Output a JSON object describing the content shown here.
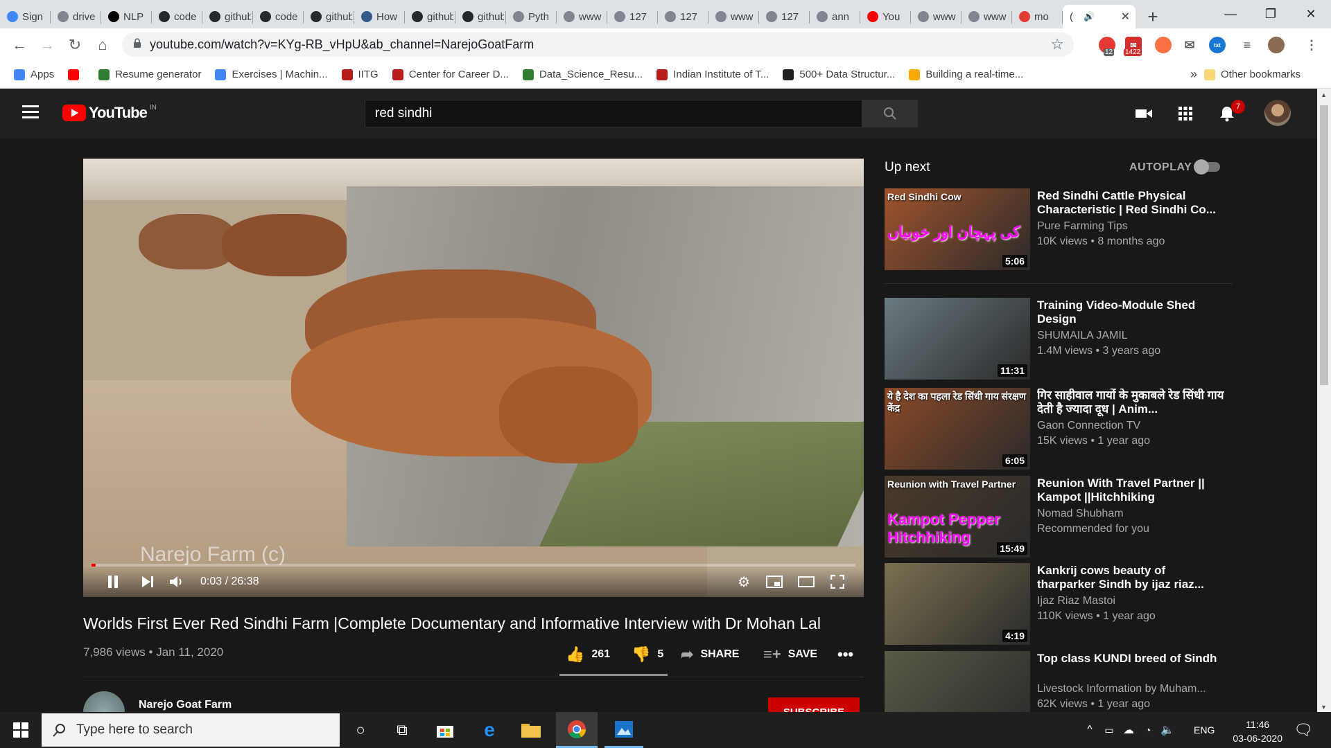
{
  "browser": {
    "tabs": [
      {
        "label": "Sign",
        "icon": "google-icon"
      },
      {
        "label": "drive",
        "icon": "globe-icon"
      },
      {
        "label": "NLP",
        "icon": "medium-icon"
      },
      {
        "label": "code",
        "icon": "github-icon"
      },
      {
        "label": "github",
        "icon": "github-icon"
      },
      {
        "label": "code",
        "icon": "github-icon"
      },
      {
        "label": "github",
        "icon": "github-icon"
      },
      {
        "label": "How",
        "icon": "tds-icon"
      },
      {
        "label": "github",
        "icon": "github-icon"
      },
      {
        "label": "github",
        "icon": "github-icon"
      },
      {
        "label": "Pyth",
        "icon": "globe-icon"
      },
      {
        "label": "www",
        "icon": "globe-icon"
      },
      {
        "label": "127",
        "icon": "globe-icon"
      },
      {
        "label": "127",
        "icon": "globe-icon"
      },
      {
        "label": "www",
        "icon": "globe-icon"
      },
      {
        "label": "127",
        "icon": "globe-icon"
      },
      {
        "label": "ann",
        "icon": "globe-icon"
      },
      {
        "label": "You",
        "icon": "youtube-icon"
      },
      {
        "label": "www",
        "icon": "globe-icon"
      },
      {
        "label": "www",
        "icon": "globe-icon"
      },
      {
        "label": "mo",
        "icon": "red-icon"
      }
    ],
    "active_tab_label": "(",
    "url": "youtube.com/watch?v=KYg-RB_vHpU&ab_channel=NarejoGoatFarm",
    "extension_badges": [
      "12",
      "1422"
    ],
    "bookmarks": [
      {
        "label": "Apps",
        "color": "#4285f4"
      },
      {
        "label": "",
        "color": "#ff0000"
      },
      {
        "label": "Resume generator",
        "color": "#2e7d32"
      },
      {
        "label": "Exercises | Machin...",
        "color": "#4285f4"
      },
      {
        "label": "IITG",
        "color": "#b71c1c"
      },
      {
        "label": "Center for Career D...",
        "color": "#b71c1c"
      },
      {
        "label": "Data_Science_Resu...",
        "color": "#2e7d32"
      },
      {
        "label": "Indian Institute of T...",
        "color": "#b71c1c"
      },
      {
        "label": "500+ Data Structur...",
        "color": "#202124"
      },
      {
        "label": "Building a real-time...",
        "color": "#f9ab00"
      }
    ],
    "more_bookmarks": "»",
    "other_bookmarks": "Other bookmarks"
  },
  "youtube": {
    "logo_text": "YouTube",
    "region": "IN",
    "search_query": "red sindhi",
    "notification_count": "7",
    "video": {
      "watermark": "Narejo Farm (c)",
      "time_current": "0:03",
      "time_total": "26:38",
      "progress": 0.002,
      "title": "Worlds First Ever Red Sindhi Farm |Complete Documentary and Informative Interview with Dr Mohan Lal",
      "views": "7,986 views",
      "date": "Jan 11, 2020",
      "likes": "261",
      "dislikes": "5",
      "share_label": "SHARE",
      "save_label": "SAVE"
    },
    "channel": {
      "name": "Narejo Goat Farm",
      "subscribe_label": "SUBSCRIBE"
    },
    "sidebar": {
      "up_next_label": "Up next",
      "autoplay_label": "AUTOPLAY",
      "autoplay_on": false,
      "recommendations": [
        {
          "title": "Red Sindhi Cattle Physical Characteristic | Red Sindhi Co...",
          "channel": "Pure Farming Tips",
          "meta": "10K views • 8 months ago",
          "duration": "5:06",
          "thumb_text": "Red Sindhi Cow",
          "thumb_subtext": "کی پہچان اور خوبیاں",
          "color": "#a0542c"
        },
        {
          "title": "Training Video-Module Shed Design",
          "channel": "SHUMAILA JAMIL",
          "meta": "1.4M views • 3 years ago",
          "duration": "11:31",
          "thumb_text": "",
          "thumb_subtext": "",
          "color": "#6a7a80"
        },
        {
          "title": "गिर साहीवाल गायों के मुकाबले रेड सिंधी गाय देती है ज्यादा दूध | Anim...",
          "channel": "Gaon Connection TV",
          "meta": "15K views • 1 year ago",
          "duration": "6:05",
          "thumb_text": "ये है देश का पहला रेड सिंधी गाय संरक्षण केंद्र",
          "thumb_subtext": "",
          "color": "#8a4a28"
        },
        {
          "title": "Reunion With Travel Partner || Kampot ||Hitchhiking",
          "channel": "Nomad Shubham",
          "meta": "Recommended for you",
          "duration": "15:49",
          "thumb_text": "Reunion with Travel Partner",
          "thumb_subtext": "Kampot Pepper Hitchhiking",
          "color": "#4a3a2a"
        },
        {
          "title": "Kankrij cows beauty of tharparker Sindh by ijaz riaz...",
          "channel": "Ijaz Riaz Mastoi",
          "meta": "110K views • 1 year ago",
          "duration": "4:19",
          "thumb_text": "",
          "thumb_subtext": "",
          "color": "#7a7050"
        },
        {
          "title": "Top class KUNDI breed of Sindh",
          "channel": "Livestock Information by Muham...",
          "meta": "62K views • 1 year ago",
          "duration": "",
          "thumb_text": "",
          "thumb_subtext": "",
          "color": "#5a5a48"
        }
      ]
    }
  },
  "taskbar": {
    "search_placeholder": "Type here to search",
    "language": "ENG",
    "time": "11:46",
    "date": "03-06-2020"
  }
}
